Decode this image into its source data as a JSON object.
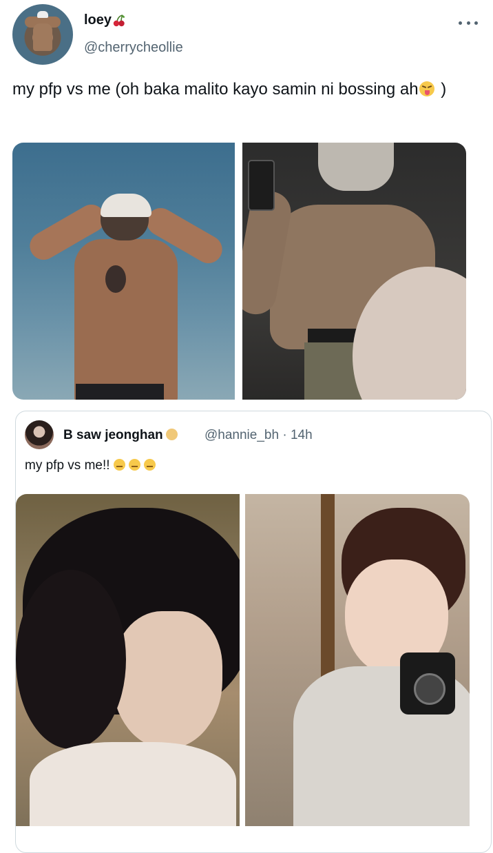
{
  "tweet": {
    "display_name": "loey",
    "name_emoji": "cherries",
    "handle": "@cherrycheollie",
    "more_label": "More",
    "text": "my pfp vs me (oh baka malito kayo samin ni bossing ah",
    "text_emoji": "squinting-tongue-face",
    "text_end": " )",
    "media": [
      {
        "description": "shirtless back at the sea, white cap, tattoo"
      },
      {
        "description": "mirror selfie of muscular back"
      }
    ]
  },
  "quoted_tweet": {
    "display_name": "B saw jeonghan",
    "name_emoji": "baby-angel",
    "handle": "@hannie_bh",
    "separator": "·",
    "time": "14h",
    "text": "my pfp vs me!!",
    "trailing_emojis": [
      "pensive-face",
      "pensive-face",
      "pensive-face"
    ],
    "media": [
      {
        "description": "side profile with wavy black hair"
      },
      {
        "description": "mirror selfie holding black camera"
      }
    ]
  },
  "colors": {
    "text": "#0f1419",
    "secondary": "#536471",
    "border": "#cfd9de"
  }
}
